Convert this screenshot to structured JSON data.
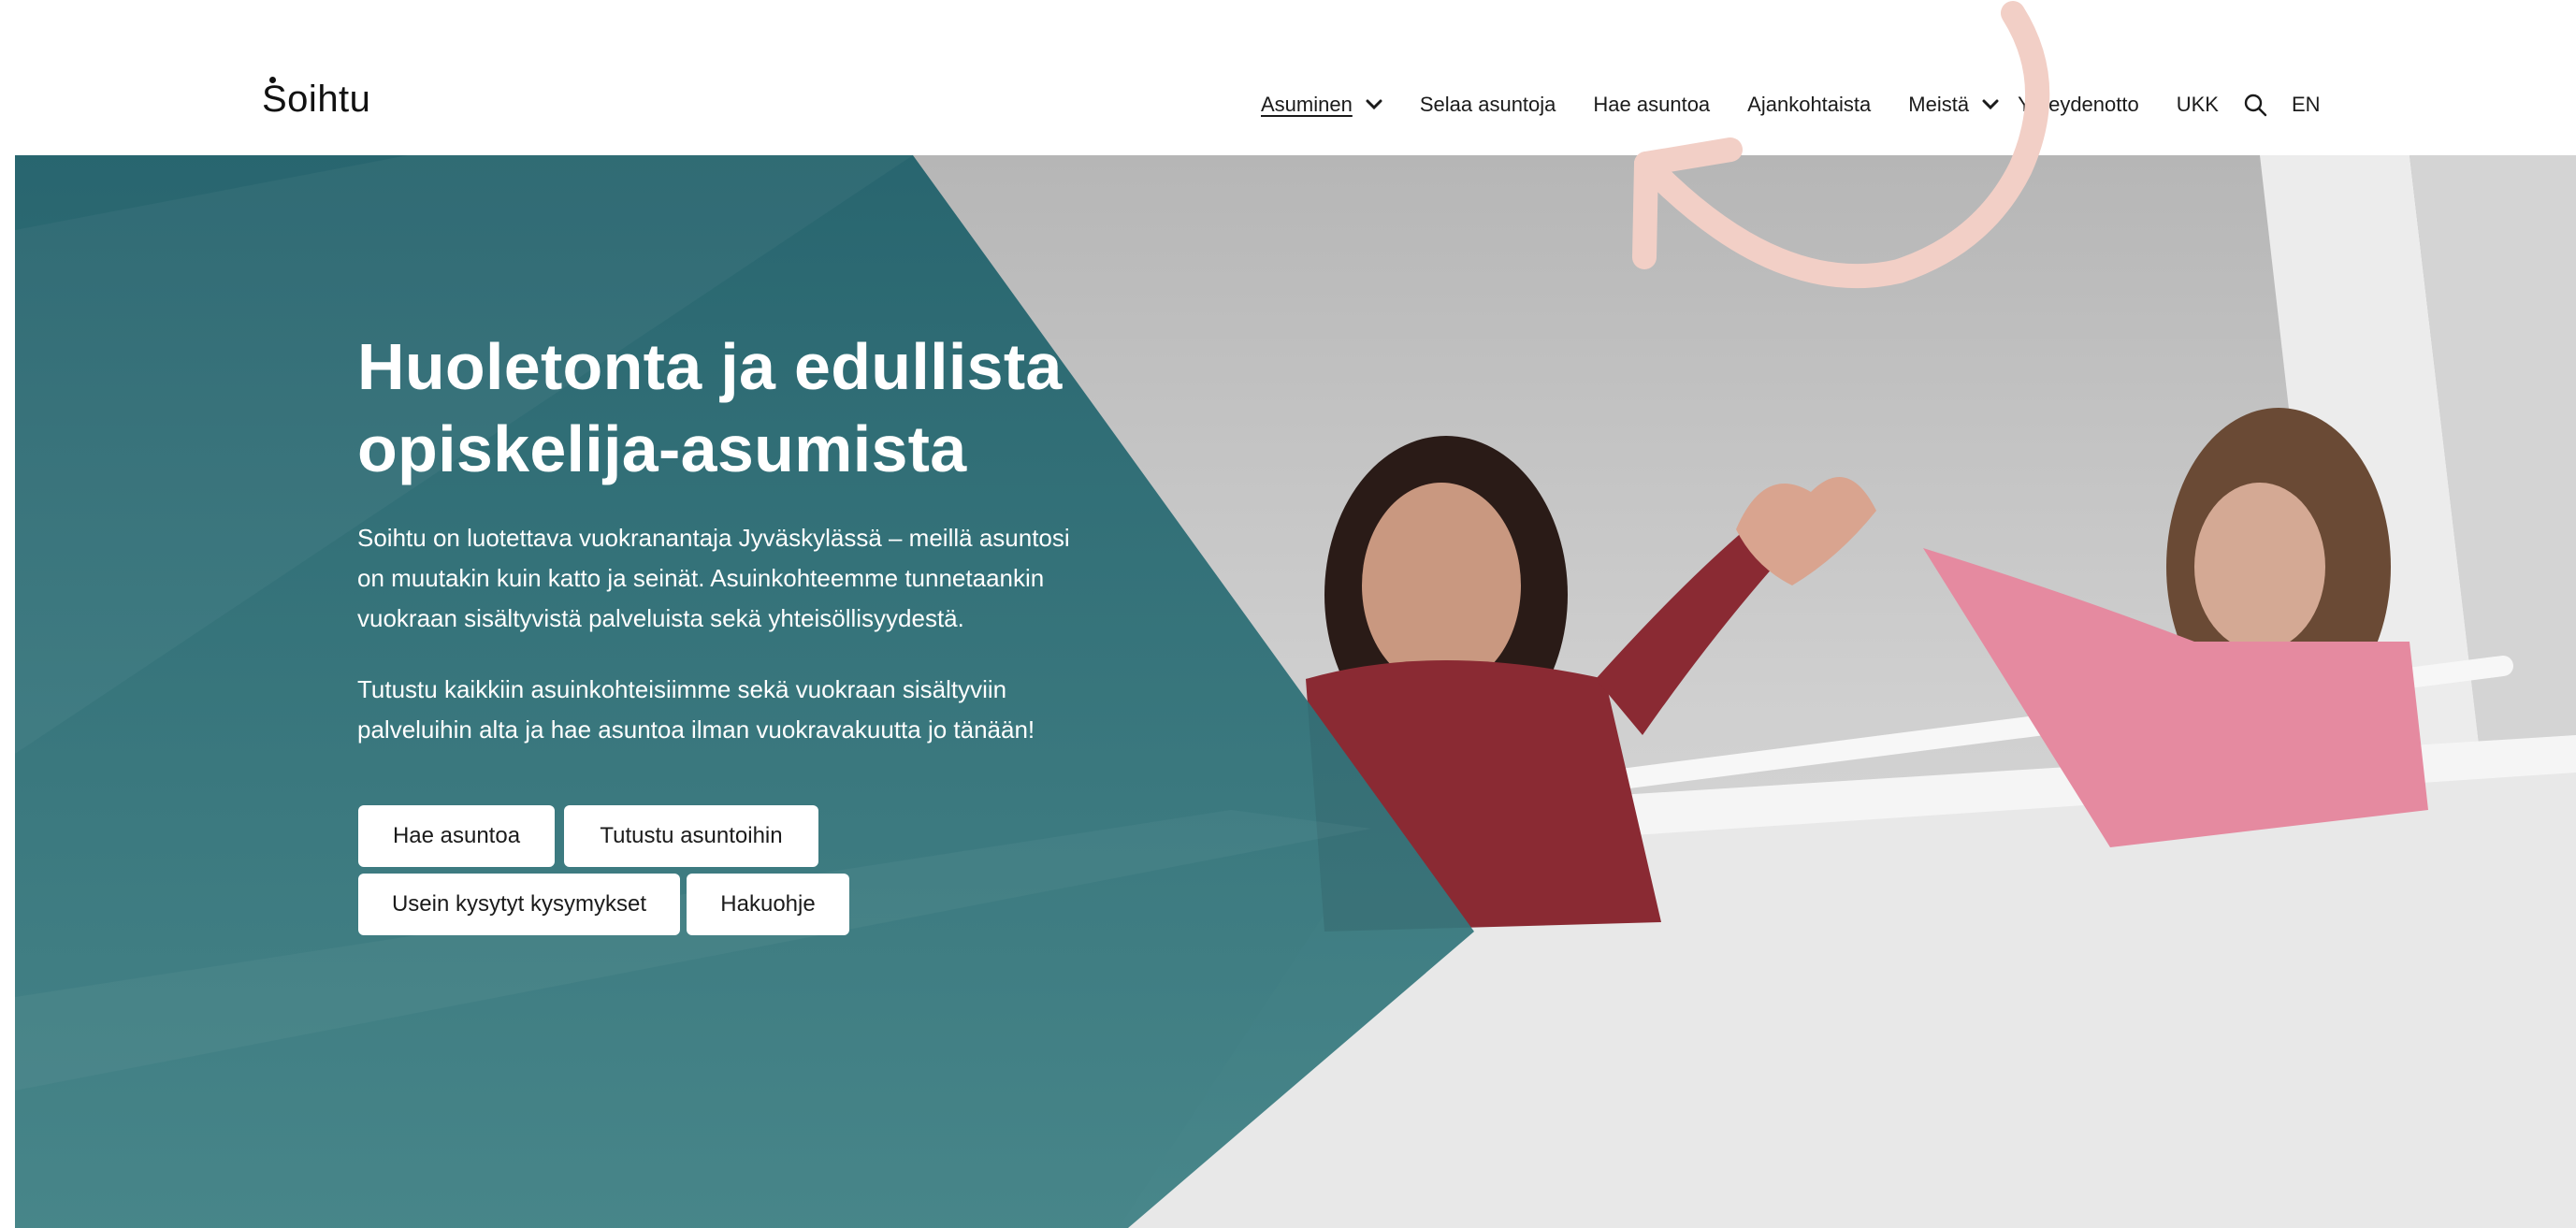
{
  "header": {
    "logo_text": "Soihtu",
    "nav": {
      "asuminen": "Asuminen",
      "selaa": "Selaa asuntoja",
      "hae": "Hae asuntoa",
      "ajankohtaista": "Ajankohtaista",
      "meista": "Meistä",
      "yhteydenotto": "Yhteydenotto",
      "ukk": "UKK",
      "lang": "EN"
    },
    "icons": {
      "search": "search-icon",
      "chevron": "chevron-down-icon"
    }
  },
  "hero": {
    "title_line1": "Huoletonta ja edullista",
    "title_line2": "opiskelija-asumista",
    "p1_line1": "Soihtu on luotettava vuokranantaja Jyväskylässä – meillä asuntosi",
    "p1_line2": "on muutakin kuin katto ja seinät. Asuinkohteemme tunnetaankin",
    "p1_line3": "vuokraan sisältyvistä palveluista sekä yhteisöllisyydestä.",
    "p2_line1": "Tutustu kaikkiin asuinkohteisiimme sekä vuokraan sisältyviin",
    "p2_line2": "palveluihin alta ja hae asuntoa ilman vuokravakuutta jo tänään!",
    "buttons": {
      "hae": "Hae asuntoa",
      "tutustu": "Tutustu asuntoihin",
      "ukk": "Usein kysytyt kysymykset",
      "hakuohje": "Hakuohje"
    }
  },
  "colors": {
    "teal": "#2b6b74",
    "annotation_arrow": "#f2cfc6",
    "button_bg": "#ffffff"
  }
}
